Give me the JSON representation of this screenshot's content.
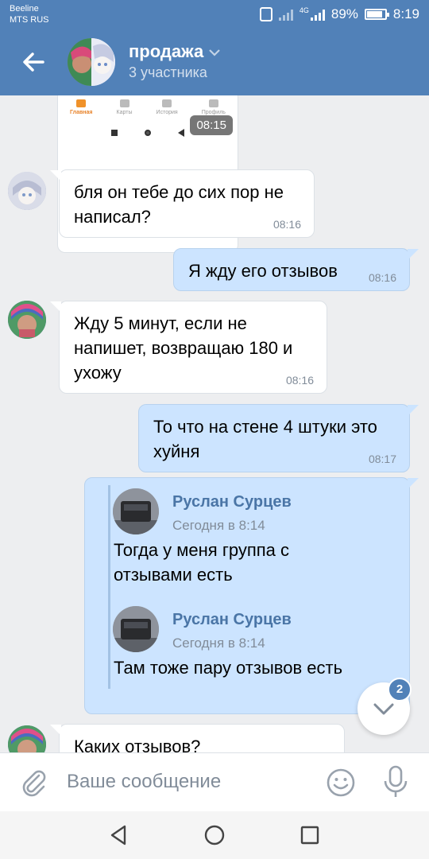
{
  "status_bar": {
    "carrier_1": "Beeline",
    "carrier_2": "MTS RUS",
    "network": "4G",
    "battery": "89%",
    "battery_level": 0.89,
    "time": "8:19"
  },
  "header": {
    "title": "продажа",
    "subtitle": "3 участника"
  },
  "screenshot_preview": {
    "tabs": [
      "Главная",
      "Карты",
      "История",
      "Профиль"
    ],
    "active_tab": "Главная",
    "time": "08:15"
  },
  "messages": [
    {
      "direction": "in",
      "text": "бля он тебе до сих пор не написал?",
      "time": "08:16"
    },
    {
      "direction": "out",
      "text": "Я жду его отзывов",
      "time": "08:16"
    },
    {
      "direction": "in",
      "text": "Жду 5 минут, если не напишет, возвращаю 180 и ухожу",
      "time": "08:16"
    },
    {
      "direction": "out",
      "text": "То что на стене 4 штуки это хуйня",
      "time": "08:17"
    },
    {
      "direction": "in",
      "text": "Каких отзывов?"
    }
  ],
  "forwarded": [
    {
      "author": "Руслан Сурцев",
      "date": "Сегодня в 8:14",
      "text": "Тогда у меня группа с отзывами есть"
    },
    {
      "author": "Руслан Сурцев",
      "date": "Сегодня в 8:14",
      "text": "Там тоже пару отзывов есть"
    }
  ],
  "scroll_down": {
    "badge": "2"
  },
  "composer": {
    "placeholder": "Ваше сообщение"
  },
  "colors": {
    "brand": "#5181b8",
    "background": "#edeef0",
    "outgoing_bubble": "#cce4ff",
    "link": "#4a75a6"
  }
}
